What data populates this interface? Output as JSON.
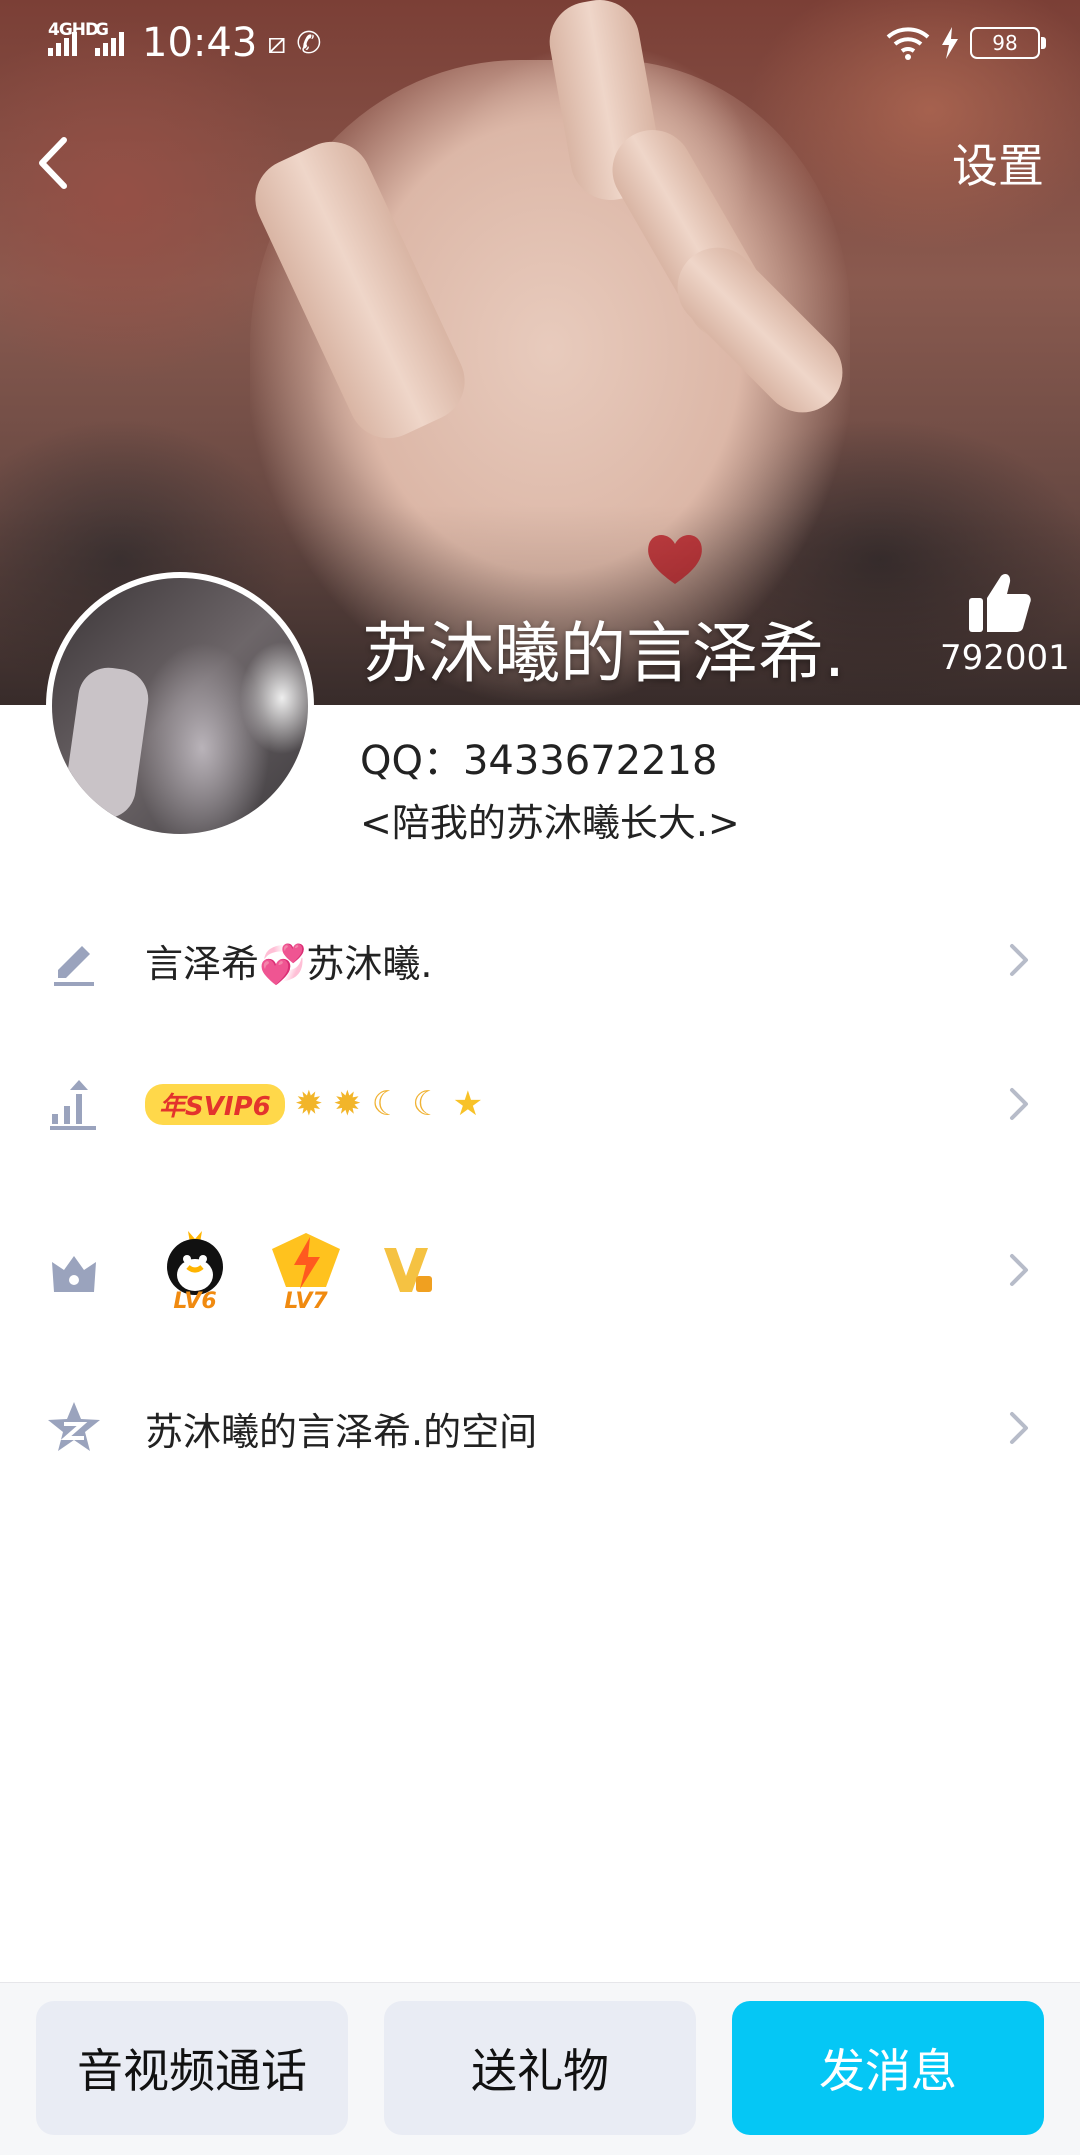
{
  "status_bar": {
    "network_1": "4GHD",
    "network_2": "G",
    "time": "10:43",
    "battery": "98"
  },
  "header": {
    "settings_label": "设置",
    "nickname": "苏沐曦的言泽希.",
    "likes": "792001"
  },
  "profile": {
    "qq_label": "QQ：3433672218",
    "signature": "<陪我的苏沐曦长大.>"
  },
  "rows": {
    "signature_text_a": "言泽希",
    "signature_emoji": "💞",
    "signature_text_b": "苏沐曦.",
    "svip_badge": "年SVIP6",
    "level_icons": [
      "sun",
      "sun",
      "moon",
      "moon",
      "star"
    ],
    "badge_lv6": "LV6",
    "badge_lv7": "LV7",
    "space_label": "苏沐曦的言泽希.的空间"
  },
  "bottom": {
    "call_label": "音视频通话",
    "gift_label": "送礼物",
    "message_label": "发消息"
  },
  "colors": {
    "accent": "#05c7f5",
    "secondary_button": "#e9ecf4",
    "icon_gray": "#9aa3bd"
  }
}
